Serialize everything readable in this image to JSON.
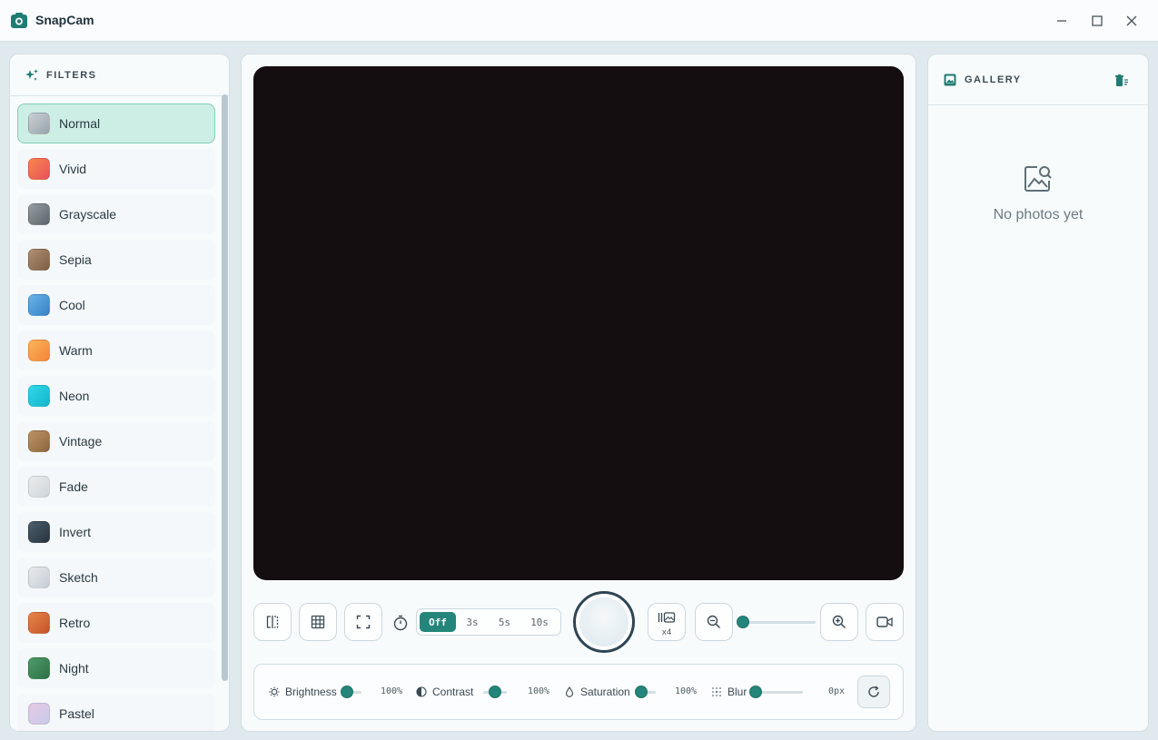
{
  "app": {
    "title": "SnapCam"
  },
  "window_controls": {
    "minimize": "minimize",
    "maximize": "maximize",
    "close": "close"
  },
  "filters": {
    "header": "FILTERS",
    "items": [
      {
        "label": "Normal",
        "color": "#b5bec4",
        "active": true
      },
      {
        "label": "Vivid",
        "color": "#f07050"
      },
      {
        "label": "Grayscale",
        "color": "#7b838a"
      },
      {
        "label": "Sepia",
        "color": "#9c7a5e"
      },
      {
        "label": "Cool",
        "color": "#4e9ad8"
      },
      {
        "label": "Warm",
        "color": "#f89a48"
      },
      {
        "label": "Neon",
        "color": "#22c9dc"
      },
      {
        "label": "Vintage",
        "color": "#a67d50"
      },
      {
        "label": "Fade",
        "color": "#dbe0e3"
      },
      {
        "label": "Invert",
        "color": "#3a4a58"
      },
      {
        "label": "Sketch",
        "color": "#d8dde2"
      },
      {
        "label": "Retro",
        "color": "#d86a38"
      },
      {
        "label": "Night",
        "color": "#3e8858"
      },
      {
        "label": "Pastel",
        "color": "#d7c8e6"
      }
    ]
  },
  "controls": {
    "timer": {
      "options": [
        "Off",
        "3s",
        "5s",
        "10s"
      ],
      "selected": "Off"
    },
    "burst_label": "x4",
    "zoom": {
      "level": 0
    }
  },
  "adjustments": [
    {
      "label": "Brightness",
      "value": "100%",
      "level": 0.1
    },
    {
      "label": "Contrast",
      "value": "100%",
      "level": 0.5
    },
    {
      "label": "Saturation",
      "value": "100%",
      "level": 0.1
    },
    {
      "label": "Blur",
      "value": "0px",
      "level": 0
    }
  ],
  "gallery": {
    "header": "GALLERY",
    "empty_text": "No photos yet"
  },
  "colors": {
    "accent": "#24857a",
    "active_bg": "#cdeee4",
    "viewfinder": "#140e11"
  }
}
